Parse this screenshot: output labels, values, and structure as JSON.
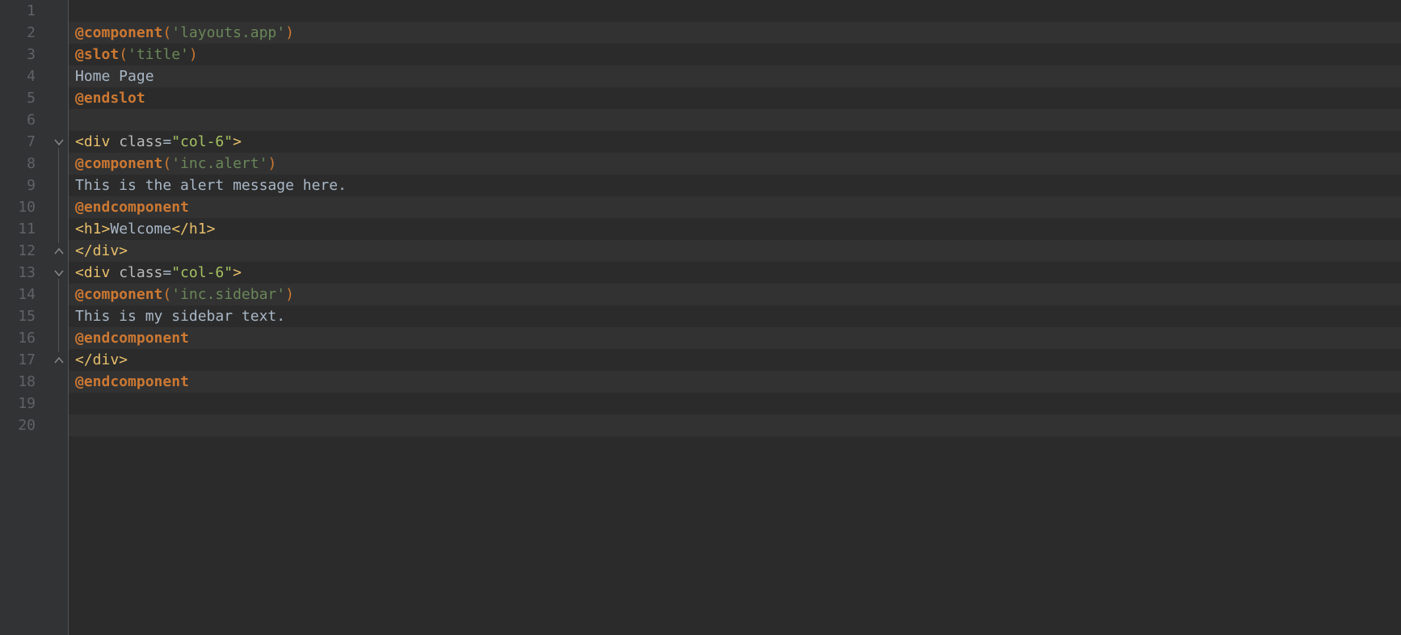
{
  "lines": {
    "count": 20,
    "numbers": [
      "1",
      "2",
      "3",
      "4",
      "5",
      "6",
      "7",
      "8",
      "9",
      "10",
      "11",
      "12",
      "13",
      "14",
      "15",
      "16",
      "17",
      "18",
      "19",
      "20"
    ]
  },
  "code": {
    "l2": {
      "d_component": "@component",
      "p1": "(",
      "s_layouts": "'layouts.app'",
      "p2": ")"
    },
    "l3": {
      "d_slot": "@slot",
      "p1": "(",
      "s_title": "'title'",
      "p2": ")"
    },
    "l4": {
      "txt_home": "Home Page"
    },
    "l5": {
      "d_endslot": "@endslot"
    },
    "l7": {
      "tag_open": "<div ",
      "attr_class": "class",
      "eq": "=",
      "val": "\"col-6\"",
      "tag_close": ">"
    },
    "l8": {
      "d_component": "@component",
      "p1": "(",
      "s_incalert": "'inc.alert'",
      "p2": ")"
    },
    "l9": {
      "txt_alert": "This is the alert message here."
    },
    "l10": {
      "d_endcomponent": "@endcomponent"
    },
    "l11": {
      "tag_h1o": "<h1>",
      "txt_welcome": "Welcome",
      "tag_h1c": "</h1>"
    },
    "l12": {
      "tag_divc": "</div>"
    },
    "l13": {
      "tag_open": "<div ",
      "attr_class": "class",
      "eq": "=",
      "val": "\"col-6\"",
      "tag_close": ">"
    },
    "l14": {
      "d_component": "@component",
      "p1": "(",
      "s_incsidebar": "'inc.sidebar'",
      "p2": ")"
    },
    "l15": {
      "txt_sidebar": "This is my sidebar text."
    },
    "l16": {
      "d_endcomponent": "@endcomponent"
    },
    "l17": {
      "tag_divc": "</div>"
    },
    "l18": {
      "d_endcomponent": "@endcomponent"
    }
  },
  "fold_markers": [
    {
      "line": 7,
      "type": "open"
    },
    {
      "line": 12,
      "type": "close"
    },
    {
      "line": 13,
      "type": "open"
    },
    {
      "line": 17,
      "type": "close"
    }
  ]
}
